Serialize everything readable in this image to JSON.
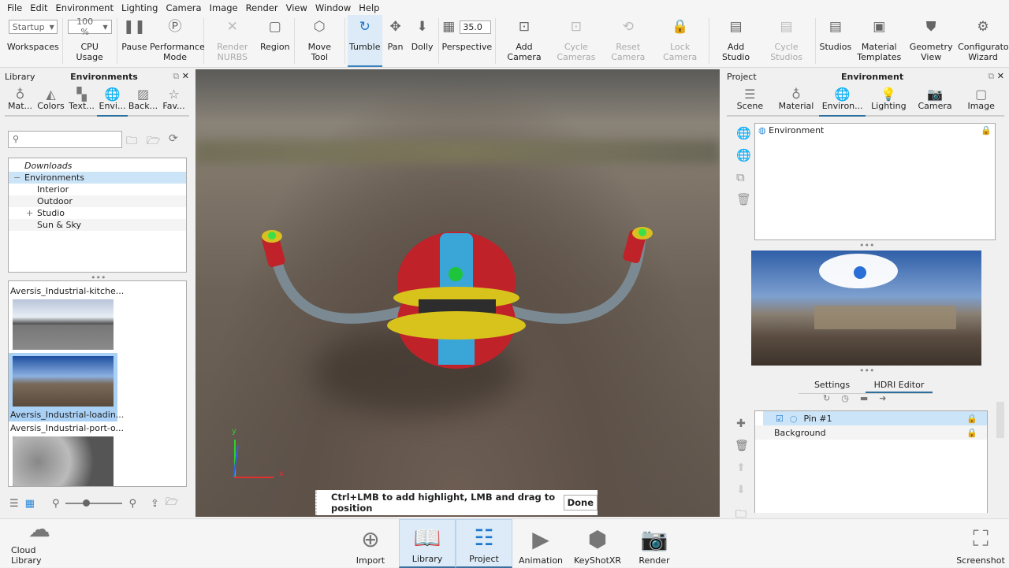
{
  "menu": [
    "File",
    "Edit",
    "Environment",
    "Lighting",
    "Camera",
    "Image",
    "Render",
    "View",
    "Window",
    "Help"
  ],
  "toolbar": {
    "workspace_value": "Startup",
    "cpu_value": "100 %",
    "fov_value": "35.0",
    "items": [
      {
        "label": "Workspaces",
        "icon": "combo",
        "combo": "workspace_value"
      },
      {
        "label": "CPU Usage",
        "icon": "combo",
        "combo": "cpu_value"
      },
      {
        "label": "Pause",
        "icon": "pause-icon",
        "glyph": "❚❚"
      },
      {
        "label": "Performance Mode",
        "icon": "performance-icon",
        "glyph": "Ⓟ"
      },
      {
        "label": "Render NURBS",
        "icon": "nurbs-icon",
        "glyph": "✕",
        "disabled": true
      },
      {
        "label": "Region",
        "icon": "region-icon",
        "glyph": "▢"
      },
      {
        "label": "Move Tool",
        "icon": "move-tool-icon",
        "glyph": "⬡"
      },
      {
        "label": "Tumble",
        "icon": "tumble-icon",
        "glyph": "↻",
        "active": true
      },
      {
        "label": "Pan",
        "icon": "pan-icon",
        "glyph": "✥"
      },
      {
        "label": "Dolly",
        "icon": "dolly-icon",
        "glyph": "⬇"
      },
      {
        "label": "Perspective",
        "icon": "perspective-icon",
        "glyph": "▦",
        "fov": true
      },
      {
        "label": "Add Camera",
        "icon": "add-camera-icon",
        "glyph": "⊡"
      },
      {
        "label": "Cycle Cameras",
        "icon": "cycle-cameras-icon",
        "glyph": "⊡",
        "disabled": true
      },
      {
        "label": "Reset Camera",
        "icon": "reset-camera-icon",
        "glyph": "⟲",
        "disabled": true
      },
      {
        "label": "Lock Camera",
        "icon": "lock-camera-icon",
        "glyph": "🔒",
        "disabled": true
      },
      {
        "label": "Add Studio",
        "icon": "add-studio-icon",
        "glyph": "▤"
      },
      {
        "label": "Cycle Studios",
        "icon": "cycle-studios-icon",
        "glyph": "▤",
        "disabled": true
      },
      {
        "label": "Studios",
        "icon": "studios-icon",
        "glyph": "▤"
      },
      {
        "label": "Material Templates",
        "icon": "material-templates-icon",
        "glyph": "▣"
      },
      {
        "label": "Geometry View",
        "icon": "geometry-view-icon",
        "glyph": "⛊"
      },
      {
        "label": "Configurator Wizard",
        "icon": "configurator-wizard-icon",
        "glyph": "⚙"
      }
    ]
  },
  "library": {
    "header_left": "Library",
    "header_title": "Environments",
    "tabs": [
      {
        "label": "Mat...",
        "icon": "material-icon",
        "glyph": "♁"
      },
      {
        "label": "Colors",
        "icon": "colors-icon",
        "glyph": "◭"
      },
      {
        "label": "Text...",
        "icon": "textures-icon",
        "glyph": "▚"
      },
      {
        "label": "Envi...",
        "icon": "globe-icon",
        "glyph": "🌐",
        "sel": true
      },
      {
        "label": "Back...",
        "icon": "backplates-icon",
        "glyph": "▨"
      },
      {
        "label": "Fav...",
        "icon": "star-icon",
        "glyph": "☆"
      }
    ],
    "search_placeholder": "",
    "tree": [
      {
        "label": "Downloads",
        "italic": true,
        "indent": 0
      },
      {
        "label": "Environments",
        "indent": 0,
        "sel": true,
        "exp": "−"
      },
      {
        "label": "Interior",
        "indent": 1
      },
      {
        "label": "Outdoor",
        "indent": 1
      },
      {
        "label": "Studio",
        "indent": 1,
        "exp": "+"
      },
      {
        "label": "Sun & Sky",
        "indent": 1
      }
    ],
    "thumbs": [
      {
        "label": "Aversis_Industrial-kitche..."
      },
      {
        "label": "Aversis_Industrial-loadin...",
        "sel": true
      },
      {
        "label": "Aversis_Industrial-port-o..."
      },
      {
        "label": ""
      }
    ]
  },
  "viewport": {
    "hint": "Ctrl+LMB to add highlight, LMB and drag to position",
    "done": "Done",
    "axis_x": "x",
    "axis_y": "y"
  },
  "project": {
    "header_left": "Project",
    "header_title": "Environment",
    "tabs": [
      {
        "label": "Scene",
        "icon": "scene-icon",
        "glyph": "☰"
      },
      {
        "label": "Material",
        "icon": "material-icon",
        "glyph": "♁"
      },
      {
        "label": "Environ...",
        "icon": "globe-icon",
        "glyph": "🌐",
        "sel": true
      },
      {
        "label": "Lighting",
        "icon": "bulb-icon",
        "glyph": "💡"
      },
      {
        "label": "Camera",
        "icon": "camera-icon",
        "glyph": "📷"
      },
      {
        "label": "Image",
        "icon": "image-icon",
        "glyph": "▢"
      }
    ],
    "env_item": "Environment",
    "subtabs": [
      "Settings",
      "HDRI Editor"
    ],
    "layers": [
      {
        "label": "Pin #1",
        "sel": true,
        "checked": true
      },
      {
        "label": "Background"
      }
    ]
  },
  "bottom": [
    {
      "label": "Cloud Library",
      "icon": "cloud-library-icon",
      "glyph": "☁"
    },
    {
      "label": "Import",
      "icon": "import-icon",
      "glyph": "⊕"
    },
    {
      "label": "Library",
      "icon": "library-book-icon",
      "glyph": "📖",
      "on": true
    },
    {
      "label": "Project",
      "icon": "project-icon",
      "glyph": "☷",
      "on": true
    },
    {
      "label": "Animation",
      "icon": "animation-icon",
      "glyph": "▶"
    },
    {
      "label": "KeyShotXR",
      "icon": "keyshotxr-icon",
      "glyph": "⬢"
    },
    {
      "label": "Render",
      "icon": "render-icon",
      "glyph": "📷"
    },
    {
      "label": "Screenshot",
      "icon": "screenshot-icon",
      "glyph": "⛶"
    }
  ]
}
